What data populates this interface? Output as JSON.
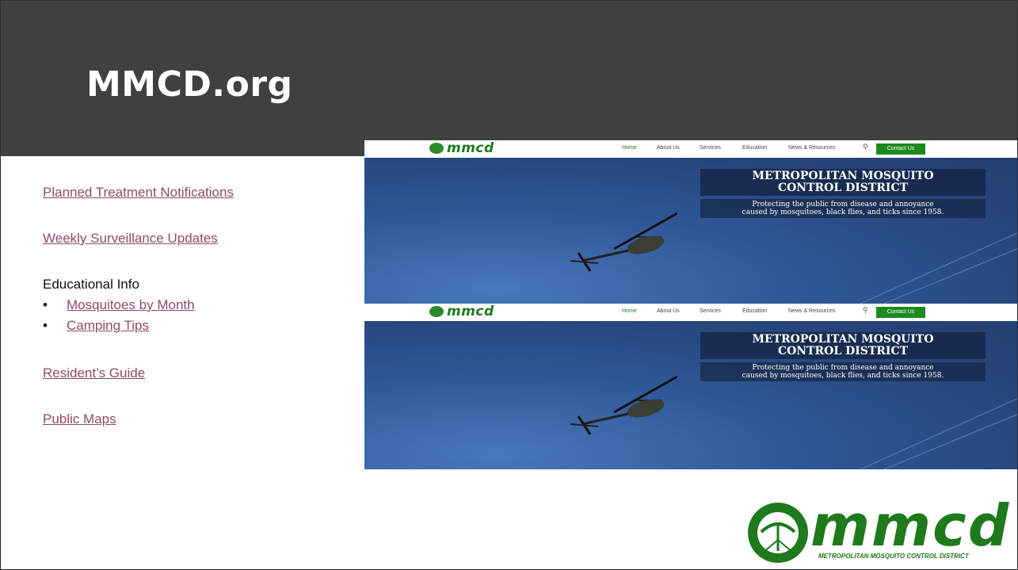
{
  "slide": {
    "title": "MMCD.org"
  },
  "links": {
    "planned": "Planned Treatment Notifications",
    "weekly": "Weekly Surveillance Updates",
    "educational_heading": "Educational Info",
    "bullets": [
      "Mosquitoes by Month",
      "Camping Tips"
    ],
    "residents": "Resident’s Guide",
    "maps": "Public Maps"
  },
  "website": {
    "brand": "mmcd",
    "nav": [
      "Home",
      "About Us",
      "Services",
      "Education",
      "News & Resources"
    ],
    "contact": "Contact Us",
    "heading_line1": "METROPOLITAN MOSQUITO",
    "heading_line2": "CONTROL DISTRICT",
    "sub_line1": "Protecting the public from disease and annoyance",
    "sub_line2": "caused by mosquitoes, black flies, and ticks since 1958."
  },
  "logo": {
    "word": "mmcd",
    "tagline": "METROPOLITAN MOSQUITO CONTROL DISTRICT"
  },
  "colors": {
    "header_bg": "#404040",
    "link": "#8e4a68",
    "brand_green": "#1e7a1c",
    "sky": "#2b4f86"
  }
}
